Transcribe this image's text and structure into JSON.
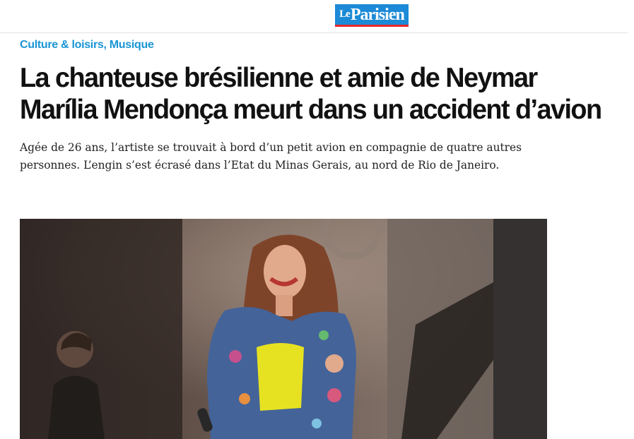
{
  "header": {
    "logo_small": "Le",
    "logo_main": "Parisien",
    "brand_colors": {
      "blue": "#1c8ad6",
      "red": "#e8282b"
    }
  },
  "breadcrumb": {
    "items": [
      {
        "label": "Culture & loisirs,"
      },
      {
        "label": "Musique"
      }
    ],
    "color": "#1a95d4"
  },
  "article": {
    "title": "La chanteuse brésilienne et amie de Neymar Marília Mendonça meurt dans un accident d’avion",
    "lead": "Agée de 26 ans, l’artiste se trouvait à bord d’un petit avion en compagnie de quatre autres personnes. L’engin s’est écrasé dans l’Etat du Minas Gerais, au nord de Rio de Janeiro."
  }
}
